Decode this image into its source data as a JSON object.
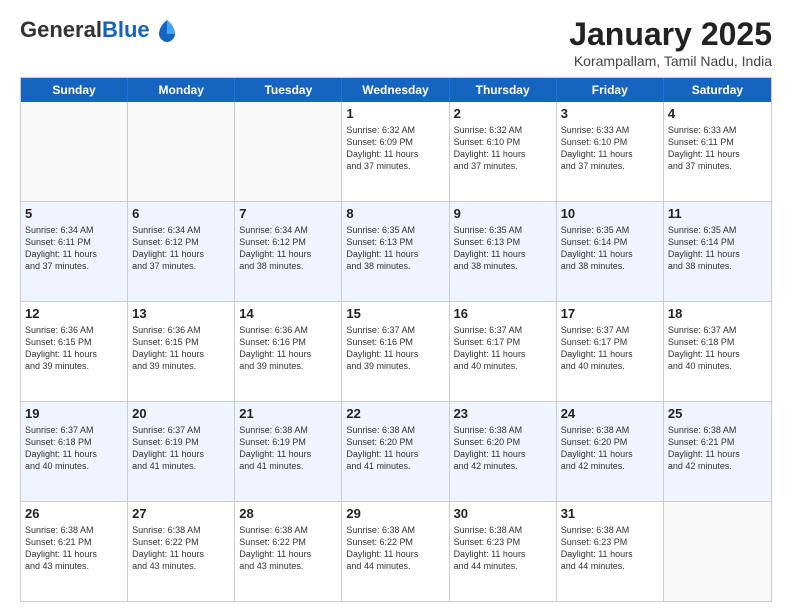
{
  "logo": {
    "general": "General",
    "blue": "Blue"
  },
  "title": "January 2025",
  "location": "Korampallam, Tamil Nadu, India",
  "days": [
    "Sunday",
    "Monday",
    "Tuesday",
    "Wednesday",
    "Thursday",
    "Friday",
    "Saturday"
  ],
  "weeks": [
    [
      {
        "day": "",
        "info": ""
      },
      {
        "day": "",
        "info": ""
      },
      {
        "day": "",
        "info": ""
      },
      {
        "day": "1",
        "info": "Sunrise: 6:32 AM\nSunset: 6:09 PM\nDaylight: 11 hours\nand 37 minutes."
      },
      {
        "day": "2",
        "info": "Sunrise: 6:32 AM\nSunset: 6:10 PM\nDaylight: 11 hours\nand 37 minutes."
      },
      {
        "day": "3",
        "info": "Sunrise: 6:33 AM\nSunset: 6:10 PM\nDaylight: 11 hours\nand 37 minutes."
      },
      {
        "day": "4",
        "info": "Sunrise: 6:33 AM\nSunset: 6:11 PM\nDaylight: 11 hours\nand 37 minutes."
      }
    ],
    [
      {
        "day": "5",
        "info": "Sunrise: 6:34 AM\nSunset: 6:11 PM\nDaylight: 11 hours\nand 37 minutes."
      },
      {
        "day": "6",
        "info": "Sunrise: 6:34 AM\nSunset: 6:12 PM\nDaylight: 11 hours\nand 37 minutes."
      },
      {
        "day": "7",
        "info": "Sunrise: 6:34 AM\nSunset: 6:12 PM\nDaylight: 11 hours\nand 38 minutes."
      },
      {
        "day": "8",
        "info": "Sunrise: 6:35 AM\nSunset: 6:13 PM\nDaylight: 11 hours\nand 38 minutes."
      },
      {
        "day": "9",
        "info": "Sunrise: 6:35 AM\nSunset: 6:13 PM\nDaylight: 11 hours\nand 38 minutes."
      },
      {
        "day": "10",
        "info": "Sunrise: 6:35 AM\nSunset: 6:14 PM\nDaylight: 11 hours\nand 38 minutes."
      },
      {
        "day": "11",
        "info": "Sunrise: 6:35 AM\nSunset: 6:14 PM\nDaylight: 11 hours\nand 38 minutes."
      }
    ],
    [
      {
        "day": "12",
        "info": "Sunrise: 6:36 AM\nSunset: 6:15 PM\nDaylight: 11 hours\nand 39 minutes."
      },
      {
        "day": "13",
        "info": "Sunrise: 6:36 AM\nSunset: 6:15 PM\nDaylight: 11 hours\nand 39 minutes."
      },
      {
        "day": "14",
        "info": "Sunrise: 6:36 AM\nSunset: 6:16 PM\nDaylight: 11 hours\nand 39 minutes."
      },
      {
        "day": "15",
        "info": "Sunrise: 6:37 AM\nSunset: 6:16 PM\nDaylight: 11 hours\nand 39 minutes."
      },
      {
        "day": "16",
        "info": "Sunrise: 6:37 AM\nSunset: 6:17 PM\nDaylight: 11 hours\nand 40 minutes."
      },
      {
        "day": "17",
        "info": "Sunrise: 6:37 AM\nSunset: 6:17 PM\nDaylight: 11 hours\nand 40 minutes."
      },
      {
        "day": "18",
        "info": "Sunrise: 6:37 AM\nSunset: 6:18 PM\nDaylight: 11 hours\nand 40 minutes."
      }
    ],
    [
      {
        "day": "19",
        "info": "Sunrise: 6:37 AM\nSunset: 6:18 PM\nDaylight: 11 hours\nand 40 minutes."
      },
      {
        "day": "20",
        "info": "Sunrise: 6:37 AM\nSunset: 6:19 PM\nDaylight: 11 hours\nand 41 minutes."
      },
      {
        "day": "21",
        "info": "Sunrise: 6:38 AM\nSunset: 6:19 PM\nDaylight: 11 hours\nand 41 minutes."
      },
      {
        "day": "22",
        "info": "Sunrise: 6:38 AM\nSunset: 6:20 PM\nDaylight: 11 hours\nand 41 minutes."
      },
      {
        "day": "23",
        "info": "Sunrise: 6:38 AM\nSunset: 6:20 PM\nDaylight: 11 hours\nand 42 minutes."
      },
      {
        "day": "24",
        "info": "Sunrise: 6:38 AM\nSunset: 6:20 PM\nDaylight: 11 hours\nand 42 minutes."
      },
      {
        "day": "25",
        "info": "Sunrise: 6:38 AM\nSunset: 6:21 PM\nDaylight: 11 hours\nand 42 minutes."
      }
    ],
    [
      {
        "day": "26",
        "info": "Sunrise: 6:38 AM\nSunset: 6:21 PM\nDaylight: 11 hours\nand 43 minutes."
      },
      {
        "day": "27",
        "info": "Sunrise: 6:38 AM\nSunset: 6:22 PM\nDaylight: 11 hours\nand 43 minutes."
      },
      {
        "day": "28",
        "info": "Sunrise: 6:38 AM\nSunset: 6:22 PM\nDaylight: 11 hours\nand 43 minutes."
      },
      {
        "day": "29",
        "info": "Sunrise: 6:38 AM\nSunset: 6:22 PM\nDaylight: 11 hours\nand 44 minutes."
      },
      {
        "day": "30",
        "info": "Sunrise: 6:38 AM\nSunset: 6:23 PM\nDaylight: 11 hours\nand 44 minutes."
      },
      {
        "day": "31",
        "info": "Sunrise: 6:38 AM\nSunset: 6:23 PM\nDaylight: 11 hours\nand 44 minutes."
      },
      {
        "day": "",
        "info": ""
      }
    ]
  ]
}
